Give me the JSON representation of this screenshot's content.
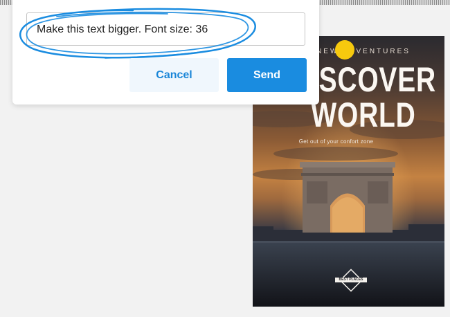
{
  "dialog": {
    "input_value": "Make this text bigger. Font size: 36",
    "cancel_label": "Cancel",
    "send_label": "Send"
  },
  "poster": {
    "eyebrow": "NEW ADVENTURES",
    "headline_line1": "DISCOVER",
    "headline_line2": "WORLD",
    "tagline": "Get out of your confort zone",
    "badge_label": "BEST PLACES"
  },
  "colors": {
    "accent": "#1a8ce0",
    "cancel_bg": "#f0f7fd",
    "annotation_stroke": "#1a8ce0",
    "cursor": "#f6c90e"
  },
  "icons": {
    "cursor": "pointer-dot-icon",
    "annotation": "circle-scribble-icon",
    "badge": "diamond-badge-icon"
  }
}
